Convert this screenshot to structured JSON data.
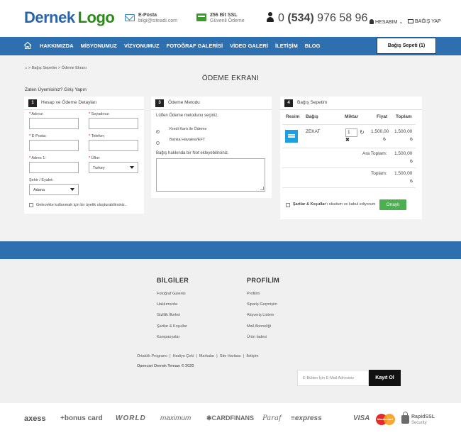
{
  "header": {
    "logo_part1": "Dernek",
    "logo_part2": "Logo",
    "email_label": "E-Posta",
    "email_value": "bilgi@siteadi.com",
    "ssl_label": "256 Bit SSL",
    "ssl_sub": "Güvenli Ödeme",
    "phone_prefix": "0",
    "phone_area": "(534)",
    "phone_number": "976 58 96",
    "account_label": "HESABIM",
    "donate_label": "BAĞIŞ YAP"
  },
  "nav": {
    "items": [
      "HAKKIMIZDA",
      "MİSYONUMUZ",
      "VİZYONUMUZ",
      "FOTOĞRAF GALERİSİ",
      "VİDEO GALERİ",
      "İLETİŞİM",
      "BLOG"
    ],
    "cart_button": "Bağış Sepeti (1)"
  },
  "breadcrumb": {
    "items": [
      "Bağış Sepetim",
      "Ödeme Ekranı"
    ],
    "separator": ">"
  },
  "page": {
    "title": "ÖDEME EKRANI",
    "login_prompt": "Zaten Üyemisiniz? Giriş Yapın"
  },
  "panel1": {
    "number": "1",
    "title": "Hesap ve Ödeme Detayları",
    "fields": {
      "name": "Adınız:",
      "surname": "Soyadınız:",
      "email": "E-Posta:",
      "phone": "Telefon:",
      "address": "Adres 1:",
      "country": "Ülke:",
      "city": "Şehir / Eyalet:"
    },
    "country_value": "Turkey",
    "city_value": "Adana",
    "create_account": "Gelecekte kullanmak için bir üyelik oluşturabilirsiniz.."
  },
  "panel2": {
    "number": "3",
    "title": "Ödeme Metodu",
    "prompt": "Lütfen Ödeme metodunu seçiniz.",
    "options": [
      "Kredi Kartı ile Ödeme",
      "Banka Havalesi/EFT"
    ],
    "note_label": "Bağış hakkında bir Not ekleyebilirsiniz."
  },
  "panel3": {
    "number": "4",
    "title": "Bağış Sepetim",
    "columns": [
      "Resim",
      "Bağış",
      "Miktar",
      "Fiyat",
      "Toplam"
    ],
    "item": {
      "name": "ZEKAT",
      "qty": "1",
      "price": "1.500,00",
      "total": "1.500,00",
      "currency": "₺"
    },
    "subtotal_label": "Ara Toplam:",
    "subtotal_value": "1.500,00",
    "total_label": "Toplam:",
    "total_value": "1.500,00",
    "currency": "₺",
    "terms_link": "Şartlar & Koşullar",
    "terms_text": "'ı okudum ve kabul ediyorum",
    "confirm_button": "Onaylı"
  },
  "footer": {
    "col1_title": "BİLGİLER",
    "col1_links": [
      "Fotoğraf Galerisi",
      "Hakkımızda",
      "Gizlilik İlkeleri",
      "Şartlar & Koşullar",
      "Kampanyalar"
    ],
    "col2_title": "PROFİLİM",
    "col2_links": [
      "Profilim",
      "Sipariş Geçmişim",
      "Alışveriş Listem",
      "Mail Aboneliği",
      "Ürün İadesi"
    ],
    "bottom_links": [
      "Ortaklık Programı",
      "Hediye Çeki",
      "Markalar",
      "Site Haritası",
      "İletişim"
    ],
    "copyright": "Opencart Dernek Teması © 2020",
    "newsletter_placeholder": "E-Bülten İçin E-Mail Adresiniz",
    "newsletter_button": "Kayıt Ol"
  },
  "payment_logos": {
    "axess": "axess",
    "bonus": "+bonus card",
    "world": "WORLD",
    "maximum": "maximum",
    "cardfinans": "CARDFINANS",
    "paraf": "Paraf",
    "express": "express",
    "visa": "VISA",
    "mastercard": "MasterCard",
    "rapidssl": "RapidSSL",
    "rapidssl_sub": "Security"
  },
  "colors": {
    "brand_blue": "#2e6fb0",
    "logo_blue": "#2a64ad",
    "logo_green": "#2c8a1a",
    "confirm_green": "#4caf50"
  }
}
